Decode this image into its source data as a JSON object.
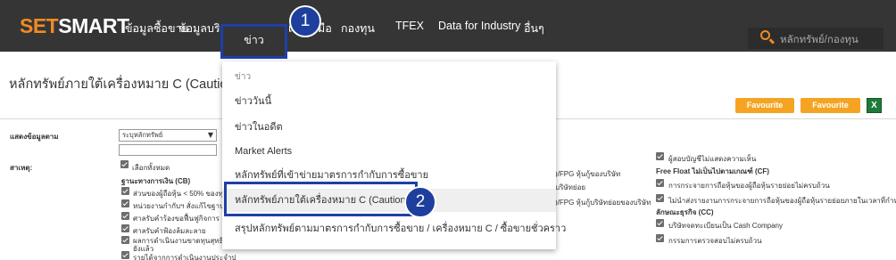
{
  "app": {
    "logo_main": "SET",
    "logo_rest": "SMART"
  },
  "nav": {
    "items": [
      "ข้อมูลซื้อขาย",
      "ข้อมูลบริษั",
      "ข่าว",
      "เครื่องมือ",
      "กองทุน",
      "TFEX",
      "Data for Industry",
      "อื่นๆ"
    ],
    "active": "ข่าว"
  },
  "search": {
    "placeholder": "หลักทรัพย์/กองทุน"
  },
  "callouts": [
    "1",
    "2"
  ],
  "page": {
    "title": "หลักทรัพย์ภายใต้เครื่องหมาย C (Caution)",
    "fav_stock": "Favourite Stock",
    "fav_query": "Favourite Query",
    "excel_label": "X"
  },
  "form": {
    "display_label": "แสดงข้อมูลตาม",
    "display_value": "ระบุหลักทรัพย์",
    "reason_label": "สาเหตุ:",
    "select_all": "เลือกทั้งหมด",
    "cb_heading": "ฐานะทางการเงิน (CB)",
    "left_items": [
      "ส่วนของผู้ถือหุ้น < 50% ของทุ",
      "หน่วยงานกำกับฯ สั่งแก้ไขฐานะ",
      "ศาลรับคำร้องขอฟื้นฟูกิจการ",
      "ศาลรับคำฟ้องล้มละลาย",
      "ผลการดำเนินงานขาดทุนสุทธิ 3",
      "ยังแล้ว",
      "รายได้จากการดำเนินงานประจำป"
    ],
    "mid_items": [
      ")/FPG หุ้นกู้ของบริษัท",
      "บริษัทย่อย",
      ")/FPG หุ้นกู้บริษัทย่อยของบริษัท"
    ],
    "right_items": [
      "ผู้สอบบัญชีไม่แสดงความเห็น",
      "การกระจายการถือหุ้นของผู้ถือหุ้นรายย่อยไม่ครบถ้วน",
      "ไม่นำส่งรายงานการกระจายการถือหุ้นของผู้ถือหุ้นรายย่อยภายในเวลาที่กำหนด",
      "บริษัทจดทะเบียนเป็น Cash Company",
      "กรรมการตรวจสอบไม่ครบถ้วน"
    ],
    "ff_heading": "Free Float ไม่เป็นไปตามเกณฑ์ (CF)",
    "cc_heading": "ลักษณะธุรกิจ (CC)"
  },
  "dropdown": {
    "items": [
      "ข่าว",
      "ข่าววันนี้",
      "ข่าวในอดีต",
      "Market Alerts",
      "หลักทรัพย์ที่เข้าข่ายมาตรการกำกับการซื้อขาย",
      "หลักทรัพย์ภายใต้เครื่องหมาย C (Caution)",
      "สรุปหลักทรัพย์ตามมาตรการกำกับการซื้อขาย / เครื่องหมาย C / ซื้อขายชั่วคราว"
    ],
    "selected_index": 5
  },
  "colors": {
    "topbar": "#353535",
    "accent_orange": "#f08a24",
    "callout_blue": "#1e3f9e",
    "favourite": "#f4a422"
  }
}
